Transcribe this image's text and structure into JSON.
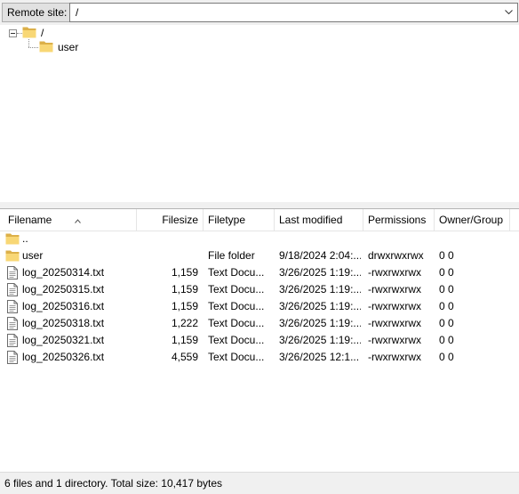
{
  "remote_site": {
    "label": "Remote site:",
    "path": "/"
  },
  "tree": {
    "root_label": "/",
    "child_label": "user"
  },
  "listing": {
    "columns": {
      "filename": "Filename",
      "filesize": "Filesize",
      "filetype": "Filetype",
      "modified": "Last modified",
      "permissions": "Permissions",
      "owner": "Owner/Group"
    },
    "sort_column": "filename",
    "parent_row": {
      "name": ".."
    },
    "rows": [
      {
        "name": "user",
        "size": "",
        "type": "File folder",
        "modified": "9/18/2024 2:04:...",
        "perms": "drwxrwxrwx",
        "owner": "0 0",
        "icon": "folder-icon"
      },
      {
        "name": "log_20250314.txt",
        "size": "1,159",
        "type": "Text Docu...",
        "modified": "3/26/2025 1:19:...",
        "perms": "-rwxrwxrwx",
        "owner": "0 0",
        "icon": "text-file-icon"
      },
      {
        "name": "log_20250315.txt",
        "size": "1,159",
        "type": "Text Docu...",
        "modified": "3/26/2025 1:19:...",
        "perms": "-rwxrwxrwx",
        "owner": "0 0",
        "icon": "text-file-icon"
      },
      {
        "name": "log_20250316.txt",
        "size": "1,159",
        "type": "Text Docu...",
        "modified": "3/26/2025 1:19:...",
        "perms": "-rwxrwxrwx",
        "owner": "0 0",
        "icon": "text-file-icon"
      },
      {
        "name": "log_20250318.txt",
        "size": "1,222",
        "type": "Text Docu...",
        "modified": "3/26/2025 1:19:...",
        "perms": "-rwxrwxrwx",
        "owner": "0 0",
        "icon": "text-file-icon"
      },
      {
        "name": "log_20250321.txt",
        "size": "1,159",
        "type": "Text Docu...",
        "modified": "3/26/2025 1:19:...",
        "perms": "-rwxrwxrwx",
        "owner": "0 0",
        "icon": "text-file-icon"
      },
      {
        "name": "log_20250326.txt",
        "size": "4,559",
        "type": "Text Docu...",
        "modified": "3/26/2025 12:1...",
        "perms": "-rwxrwxrwx",
        "owner": "0 0",
        "icon": "text-file-icon"
      }
    ]
  },
  "status": {
    "text": "6 files and 1 directory. Total size: 10,417 bytes"
  },
  "colors": {
    "folder": "#f8d775",
    "folder_dark": "#dcb049",
    "chrome": "#f0f0f0"
  }
}
